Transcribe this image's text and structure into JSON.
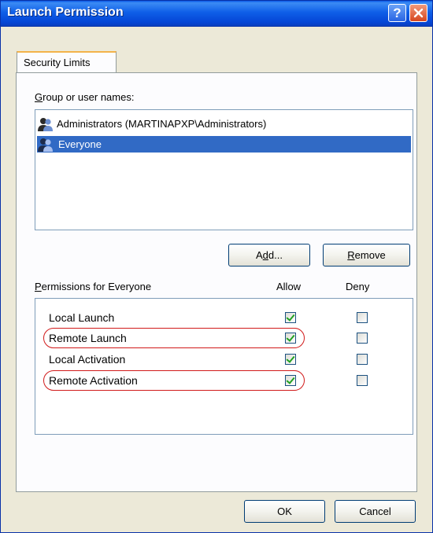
{
  "window": {
    "title": "Launch Permission"
  },
  "tabs": [
    {
      "label": "Security Limits"
    }
  ],
  "group_section": {
    "label": "Group or user names:",
    "users": [
      {
        "name": "Administrators (MARTINAPXP\\Administrators)",
        "icon": "user-group-icon",
        "selected": false
      },
      {
        "name": "Everyone",
        "icon": "user-group-icon",
        "selected": true
      }
    ],
    "add_button": "Add...",
    "remove_button": "Remove"
  },
  "permissions": {
    "header": "Permissions for Everyone",
    "allow_header": "Allow",
    "deny_header": "Deny",
    "rows": [
      {
        "name": "Local Launch",
        "allow": true,
        "deny": false,
        "highlighted": false
      },
      {
        "name": "Remote Launch",
        "allow": true,
        "deny": false,
        "highlighted": true
      },
      {
        "name": "Local Activation",
        "allow": true,
        "deny": false,
        "highlighted": false
      },
      {
        "name": "Remote Activation",
        "allow": true,
        "deny": false,
        "highlighted": true
      }
    ]
  },
  "footer": {
    "ok_button": "OK",
    "cancel_button": "Cancel"
  },
  "colors": {
    "selection": "#316ac5",
    "highlight_oval": "#d11a1a",
    "check": "#21a121",
    "titlebar": "#0546d6"
  }
}
